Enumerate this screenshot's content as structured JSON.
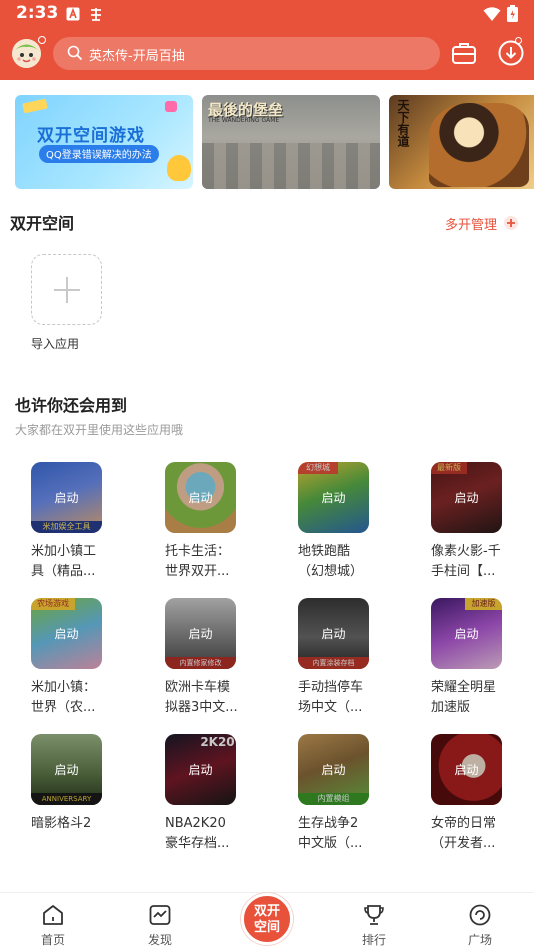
{
  "status_bar": {
    "time": "2:33"
  },
  "header": {
    "search_text": "英杰传-开局百抽",
    "brand_color": "#e8523b",
    "icons": [
      "avatar",
      "search-icon",
      "briefcase-icon",
      "download-icon"
    ]
  },
  "banners": [
    {
      "title": "双开空间游戏",
      "subtitle": "QQ登录错误解决的办法"
    },
    {
      "title": "最後的堡垒",
      "subtitle": "THE WANDERING GAME"
    },
    {
      "title": "天下有道"
    }
  ],
  "dual_space": {
    "title": "双开空间",
    "manage_label": "多开管理",
    "import_label": "导入应用"
  },
  "suggestions": {
    "title": "也许你还会用到",
    "subtitle": "大家都在双开里使用这些应用哦",
    "launch_label": "启动",
    "apps": [
      {
        "name_line1": "米加小镇工",
        "name_line2": "具（精品...",
        "tag": "米加娱全工具"
      },
      {
        "name_line1": "托卡生活：",
        "name_line2": "世界双开..."
      },
      {
        "name_line1": "地铁跑酷",
        "name_line2": "（幻想城）",
        "tag": "幻想城"
      },
      {
        "name_line1": "像素火影-千",
        "name_line2": "手柱间【...",
        "tag": "最新版"
      },
      {
        "name_line1": "米加小镇：",
        "name_line2": "世界（农...",
        "tag": "农场游戏"
      },
      {
        "name_line1": "欧洲卡车模",
        "name_line2": "拟器3中文...",
        "tag": "内置修家修改"
      },
      {
        "name_line1": "手动挡停车",
        "name_line2": "场中文（...",
        "tag": "内置涂装存档"
      },
      {
        "name_line1": "荣耀全明星",
        "name_line2": "加速版",
        "tag": "加速版"
      },
      {
        "name_line1": "暗影格斗2",
        "name_line2": "",
        "tag": "ANNIVERSARY"
      },
      {
        "name_line1": "NBA2K20",
        "name_line2": "豪华存档...",
        "tag": "2K20"
      },
      {
        "name_line1": "生存战争2",
        "name_line2": "中文版（...",
        "tag": "内置模组"
      },
      {
        "name_line1": "女帝的日常",
        "name_line2": "（开发者..."
      }
    ]
  },
  "bottom_nav": {
    "home": "首页",
    "discover": "发现",
    "center": "双开\n空间",
    "rank": "排行",
    "plaza": "广场"
  }
}
